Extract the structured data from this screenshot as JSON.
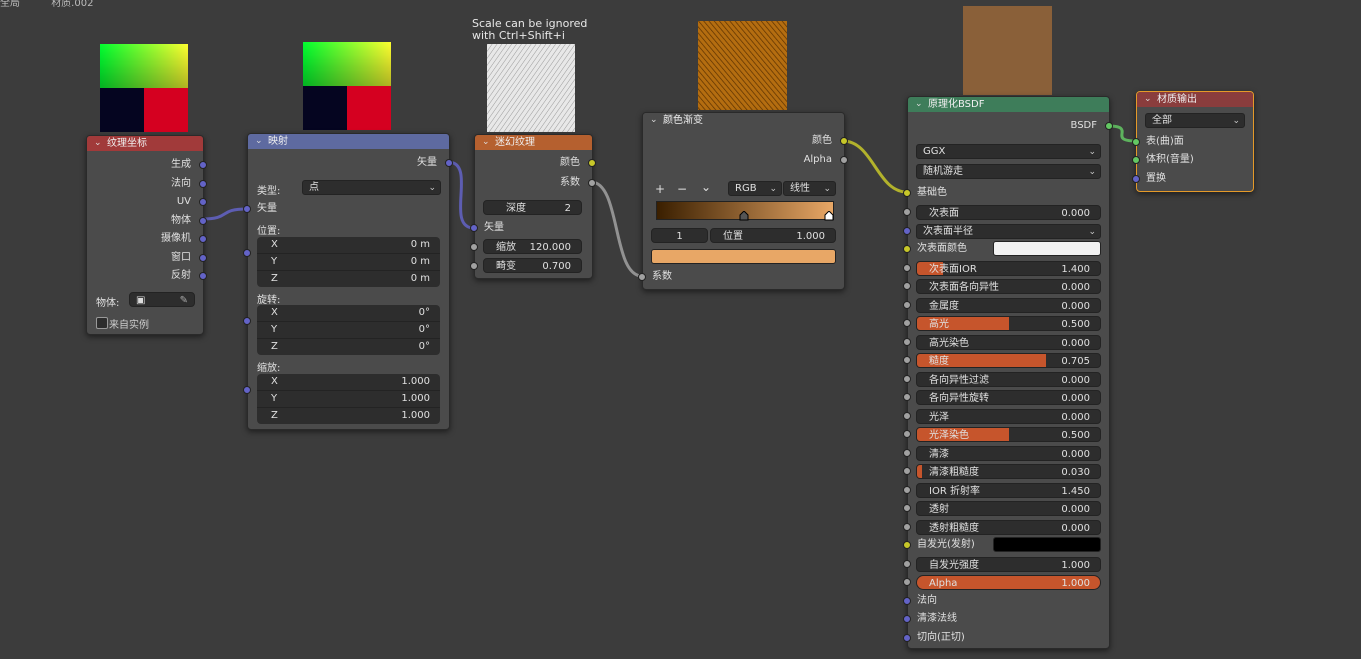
{
  "topbar": {
    "item1": "全局",
    "item2": "材质.002"
  },
  "annotation": {
    "line1": "Scale can be ignored",
    "line2": "with Ctrl+Shift+i"
  },
  "tex_coord": {
    "title": "纹理坐标",
    "outputs": [
      "生成",
      "法向",
      "UV",
      "物体",
      "摄像机",
      "窗口",
      "反射"
    ],
    "object_label": "物体:",
    "from_instancer": "来自实例"
  },
  "mapping": {
    "title": "映射",
    "output": "矢量",
    "type_label": "类型:",
    "type_value": "点",
    "input_vector": "矢量",
    "location_label": "位置:",
    "location": [
      {
        "axis": "X",
        "value": "0 m"
      },
      {
        "axis": "Y",
        "value": "0 m"
      },
      {
        "axis": "Z",
        "value": "0 m"
      }
    ],
    "rotation_label": "旋转:",
    "rotation": [
      {
        "axis": "X",
        "value": "0°"
      },
      {
        "axis": "Y",
        "value": "0°"
      },
      {
        "axis": "Z",
        "value": "0°"
      }
    ],
    "scale_label": "缩放:",
    "scale": [
      {
        "axis": "X",
        "value": "1.000"
      },
      {
        "axis": "Y",
        "value": "1.000"
      },
      {
        "axis": "Z",
        "value": "1.000"
      }
    ]
  },
  "magic": {
    "title": "迷幻纹理",
    "out_color": "颜色",
    "out_fac": "系数",
    "depth_label": "深度",
    "depth_value": "2",
    "vector": "矢量",
    "scale_label": "缩放",
    "scale_value": "120.000",
    "distortion_label": "畸变",
    "distortion_value": "0.700"
  },
  "ramp": {
    "title": "颜色渐变",
    "out_color": "颜色",
    "out_alpha": "Alpha",
    "btn_add": "+",
    "btn_remove": "−",
    "btn_menu": "⌄",
    "color_mode": "RGB",
    "interpolation": "线性",
    "stop_index": "1",
    "position_label": "位置",
    "position_value": "1.000",
    "input_fac": "系数",
    "stop_color": "#e8a766"
  },
  "bsdf": {
    "title": "原理化BSDF",
    "output": "BSDF",
    "distribution": "GGX",
    "subsurface_method": "随机游走",
    "base_color": "基础色",
    "rows": [
      {
        "label": "次表面",
        "value": "0.000",
        "fill": 0
      },
      {
        "label": "次表面半径",
        "value": "",
        "fill": 0,
        "kind": "dropdown"
      },
      {
        "label": "次表面颜色",
        "value": "",
        "fill": 0,
        "kind": "color"
      },
      {
        "label": "次表面IOR",
        "value": "1.400",
        "fill": 0.14
      },
      {
        "label": "次表面各向异性",
        "value": "0.000",
        "fill": 0
      },
      {
        "label": "金属度",
        "value": "0.000",
        "fill": 0
      },
      {
        "label": "高光",
        "value": "0.500",
        "fill": 0.5
      },
      {
        "label": "高光染色",
        "value": "0.000",
        "fill": 0
      },
      {
        "label": "糙度",
        "value": "0.705",
        "fill": 0.705
      },
      {
        "label": "各向异性过滤",
        "value": "0.000",
        "fill": 0
      },
      {
        "label": "各向异性旋转",
        "value": "0.000",
        "fill": 0
      },
      {
        "label": "光泽",
        "value": "0.000",
        "fill": 0
      },
      {
        "label": "光泽染色",
        "value": "0.500",
        "fill": 0.5
      },
      {
        "label": "清漆",
        "value": "0.000",
        "fill": 0
      },
      {
        "label": "清漆粗糙度",
        "value": "0.030",
        "fill": 0.03
      },
      {
        "label": "IOR 折射率",
        "value": "1.450",
        "fill": 0
      },
      {
        "label": "透射",
        "value": "0.000",
        "fill": 0
      },
      {
        "label": "透射粗糙度",
        "value": "0.000",
        "fill": 0
      },
      {
        "label": "自发光(发射)",
        "value": "",
        "fill": 0,
        "kind": "color"
      },
      {
        "label": "自发光强度",
        "value": "1.000",
        "fill": 0
      },
      {
        "label": "Alpha",
        "value": "1.000",
        "fill": 1
      },
      {
        "label": "法向",
        "value": "",
        "fill": 0,
        "kind": "socket"
      },
      {
        "label": "清漆法线",
        "value": "",
        "fill": 0,
        "kind": "socket"
      },
      {
        "label": "切向(正切)",
        "value": "",
        "fill": 0,
        "kind": "socket"
      }
    ],
    "subsurface_color": "#f2f2f2",
    "emission_color": "#000000"
  },
  "output": {
    "title": "材质输出",
    "target": "全部",
    "surface": "表(曲)面",
    "volume": "体积(音量)",
    "displacement": "置换"
  },
  "colors": {
    "header_input": "#a13a3a",
    "header_vector": "#5e6aa0",
    "header_texture": "#b5602f",
    "header_converter": "#4b4b4b",
    "header_shader": "#3e7d5a",
    "header_output": "#8a3d3d",
    "wire_vector": "#6363c7",
    "wire_color": "#c7c729",
    "wire_float": "#a1a1a1",
    "wire_shader": "#63c763"
  }
}
